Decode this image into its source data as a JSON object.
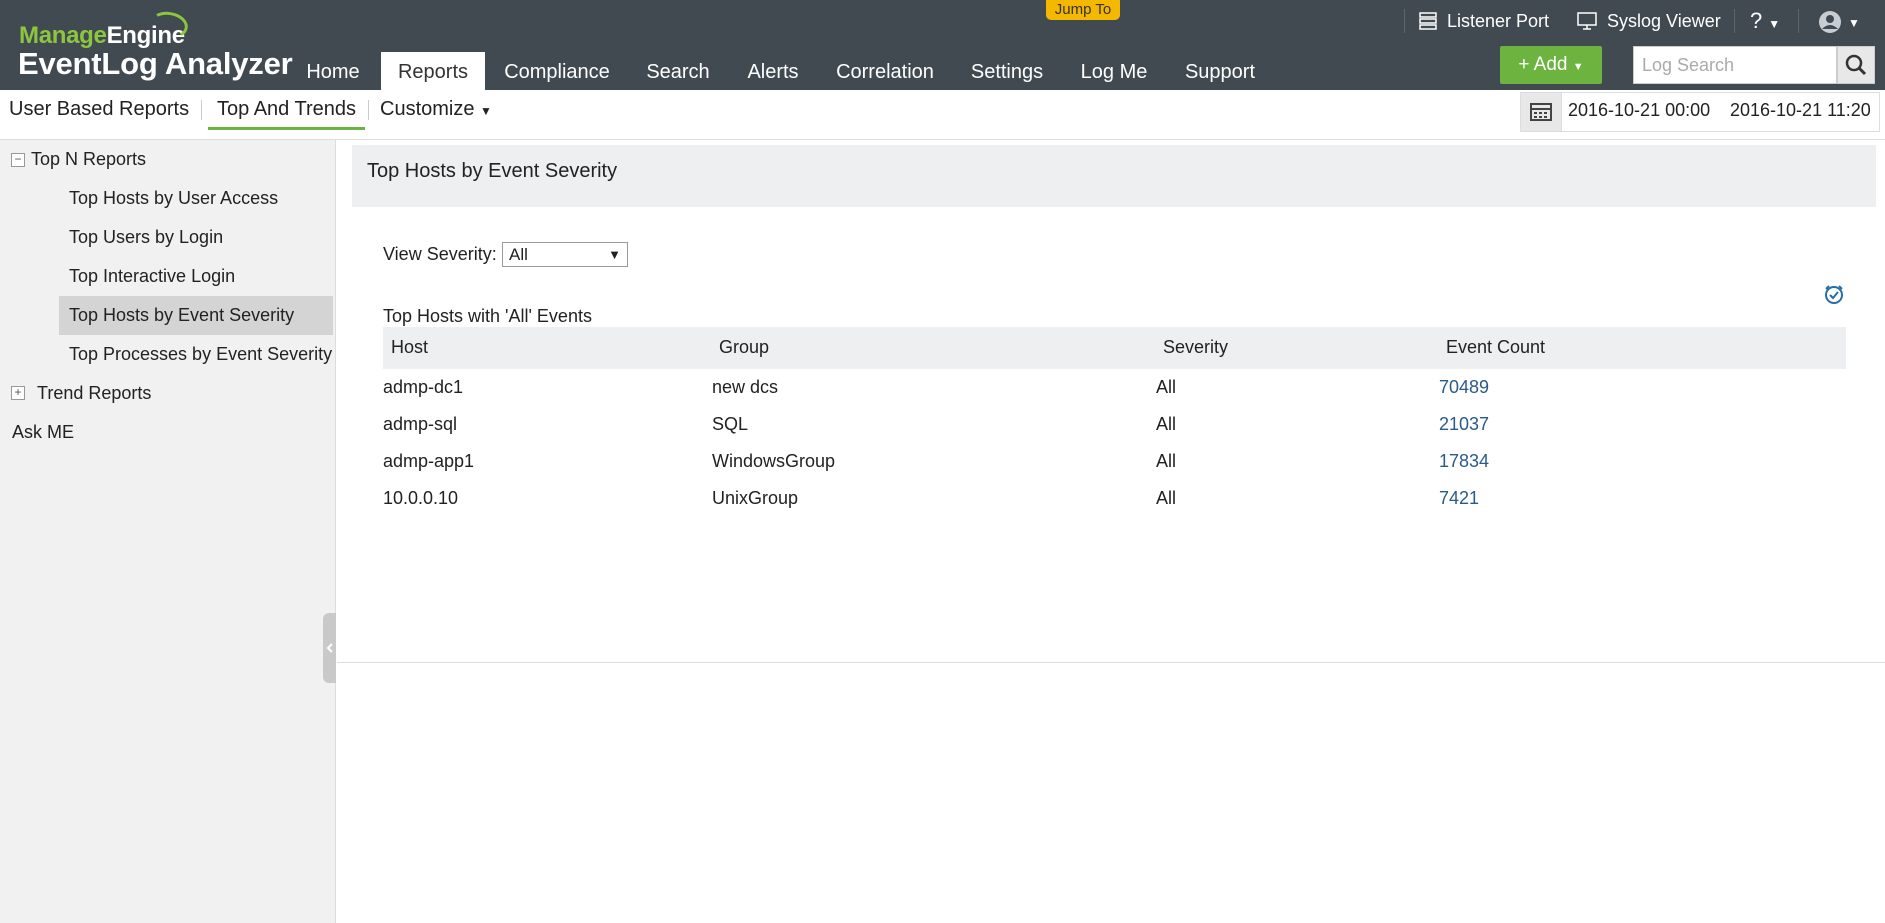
{
  "header": {
    "logo_top": "ManageEngine",
    "logo_top_accent": "Manage",
    "logo_top_rest": "Engine",
    "product": "EventLog Analyzer",
    "jump_to": "Jump To",
    "listener_port": "Listener Port",
    "syslog_viewer": "Syslog Viewer",
    "help": "?",
    "nav": [
      "Home",
      "Reports",
      "Compliance",
      "Search",
      "Alerts",
      "Correlation",
      "Settings",
      "Log Me",
      "Support"
    ],
    "active_nav": "Reports",
    "add_label": "+ Add",
    "search_placeholder": "Log Search"
  },
  "subnav": {
    "tabs": [
      "User Based Reports",
      "Top And Trends"
    ],
    "active_tab": "Top And Trends",
    "customize": "Customize",
    "date_from": "2016-10-21 00:00",
    "date_to": "2016-10-21 11:20"
  },
  "sidebar": {
    "groups": [
      {
        "label": "Top N Reports",
        "expanded": true,
        "items": [
          "Top Hosts by User Access",
          "Top Users by Login",
          "Top Interactive Login",
          "Top Hosts by Event Severity",
          "Top Processes by Event Severity"
        ]
      },
      {
        "label": "Trend Reports",
        "expanded": false
      },
      {
        "label": "Ask ME"
      }
    ],
    "selected": "Top Hosts by Event Severity"
  },
  "report": {
    "title": "Top Hosts by Event Severity",
    "view_severity_label": "View Severity:",
    "view_severity_value": "All",
    "table_caption": "Top Hosts with 'All' Events",
    "columns": [
      "Host",
      "Group",
      "Severity",
      "Event Count"
    ],
    "rows": [
      [
        "admp-dc1",
        "new dcs",
        "All",
        "70489"
      ],
      [
        "admp-sql",
        "SQL",
        "All",
        "21037"
      ],
      [
        "admp-app1",
        "WindowsGroup",
        "All",
        "17834"
      ],
      [
        "10.0.0.10",
        "UnixGroup",
        "All",
        "7421"
      ]
    ]
  },
  "colors": {
    "header_bg": "#414a51",
    "accent_green": "#6cb33f",
    "logo_green": "#8cc63f",
    "jump_to_bg": "#f5b800",
    "link_blue": "#2a5a8c"
  }
}
